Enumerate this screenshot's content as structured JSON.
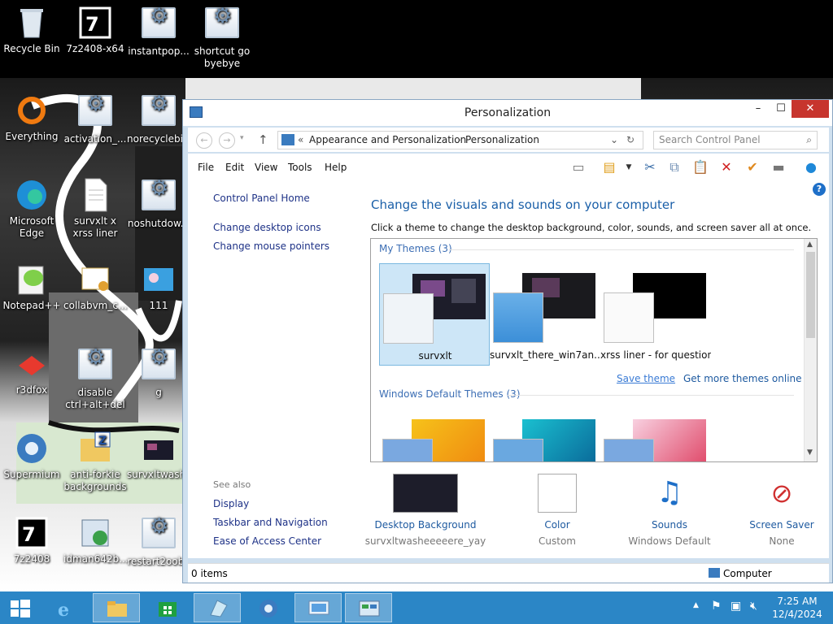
{
  "desktop": {
    "icons": [
      {
        "label": "Recycle Bin",
        "icon": "recycle-bin-icon"
      },
      {
        "label": "7z2408-x64",
        "icon": "7zip-icon"
      },
      {
        "label": "instantpop...",
        "icon": "shortcut-gear-icon"
      },
      {
        "label": "shortcut go byebye",
        "icon": "shortcut-gear-icon"
      },
      {
        "label": "Everything",
        "icon": "everything-icon"
      },
      {
        "label": "activation_...",
        "icon": "shortcut-gear-icon"
      },
      {
        "label": "norecyclebi...",
        "icon": "shortcut-gear-icon"
      },
      {
        "label": "Microsoft Edge",
        "icon": "edge-icon"
      },
      {
        "label": "survxlt x xrss liner",
        "icon": "text-file-icon"
      },
      {
        "label": "noshutdow...",
        "icon": "shortcut-gear-icon"
      },
      {
        "label": "Notepad++",
        "icon": "notepadpp-icon"
      },
      {
        "label": "collabvm_c...",
        "icon": "certificate-icon"
      },
      {
        "label": "111",
        "icon": "image-file-icon"
      },
      {
        "label": "r3dfox",
        "icon": "r3dfox-icon"
      },
      {
        "label": "disable ctrl+alt+del",
        "icon": "shortcut-gear-icon"
      },
      {
        "label": "g",
        "icon": "shortcut-gear-icon"
      },
      {
        "label": "Supermium",
        "icon": "supermium-icon"
      },
      {
        "label": "anti-forkie backgrounds",
        "icon": "zip-folder-icon"
      },
      {
        "label": "survxltwash...",
        "icon": "image-file-icon"
      },
      {
        "label": "7z2408",
        "icon": "7zip-icon"
      },
      {
        "label": "idman642b...",
        "icon": "installer-icon"
      },
      {
        "label": "restart2oobe",
        "icon": "shortcut-gear-icon"
      }
    ]
  },
  "window": {
    "title": "Personalization",
    "address": {
      "root_chevrons": "«",
      "crumb1": "Appearance and Personalization",
      "sep": "›",
      "crumb2": "Personalization"
    },
    "search_placeholder": "Search Control Panel",
    "menu": [
      "File",
      "Edit",
      "View",
      "Tools",
      "Help"
    ],
    "sidebar": {
      "home": "Control Panel Home",
      "links": [
        "Change desktop icons",
        "Change mouse pointers"
      ],
      "see_also": "See also",
      "see_also_links": [
        "Display",
        "Taskbar and Navigation",
        "Ease of Access Center"
      ]
    },
    "main": {
      "heading": "Change the visuals and sounds on your computer",
      "subheading": "Click a theme to change the desktop background, color, sounds, and screen saver all at once.",
      "my_themes_label": "My Themes (3)",
      "my_themes": [
        {
          "name": "survxlt",
          "selected": true
        },
        {
          "name": "survxlt_there_win7an...",
          "selected": false
        },
        {
          "name": "xrss liner - for question",
          "selected": false
        }
      ],
      "save_theme": "Save theme",
      "get_more": "Get more themes online",
      "default_themes_label": "Windows Default Themes (3)"
    },
    "bottom": [
      {
        "name": "Desktop Background",
        "value": "survxltwasheeeeere_yay"
      },
      {
        "name": "Color",
        "value": "Custom"
      },
      {
        "name": "Sounds",
        "value": "Windows Default"
      },
      {
        "name": "Screen Saver",
        "value": "None"
      }
    ],
    "status": {
      "items": "0 items",
      "location": "Computer"
    }
  },
  "taskbar": {
    "time": "7:25 AM",
    "date": "12/4/2024",
    "pinned": [
      "start-icon",
      "internet-explorer-icon",
      "file-explorer-icon",
      "store-icon",
      "glass-app-icon",
      "supermium-icon",
      "remote-desktop-icon",
      "control-panel-icon"
    ]
  },
  "colors": {
    "accent": "#2b86c6",
    "close": "#c7352e",
    "link": "#1e3287",
    "heading": "#1a5fa8"
  }
}
